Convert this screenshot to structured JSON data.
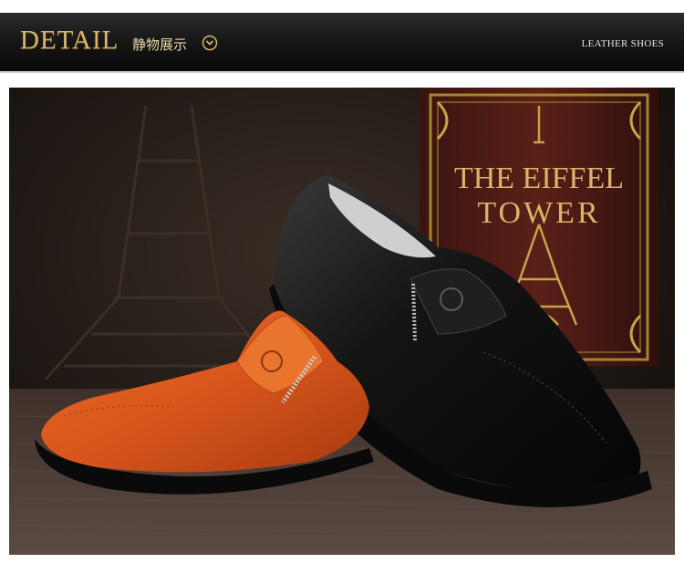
{
  "header": {
    "title": "DETAIL",
    "subtitle": "静物展示",
    "right_label": "LEATHER SHOES",
    "chevron_icon": "chevron-down-circle-icon",
    "title_color": "#d8b56a"
  },
  "photo": {
    "book_line1": "THE EIFFEL",
    "book_line2": "TOWER"
  }
}
